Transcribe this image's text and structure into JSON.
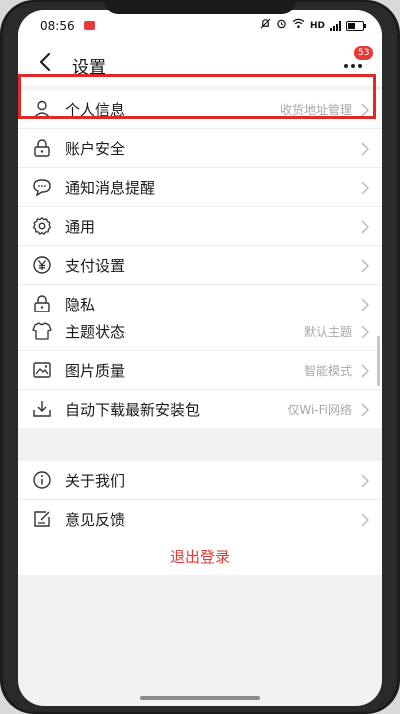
{
  "status_bar": {
    "time": "08:56",
    "network": "HD"
  },
  "header": {
    "title": "设置",
    "badge_count": "53"
  },
  "groups": [
    {
      "items": [
        {
          "label": "个人信息",
          "hint": "收货地址管理",
          "icon": "person-icon"
        },
        {
          "label": "账户安全",
          "hint": "",
          "icon": "lock-icon"
        },
        {
          "label": "通知消息提醒",
          "hint": "",
          "icon": "chat-icon"
        },
        {
          "label": "通用",
          "hint": "",
          "icon": "gear-icon"
        },
        {
          "label": "支付设置",
          "hint": "",
          "icon": "yen-icon"
        },
        {
          "label": "隐私",
          "hint": "",
          "icon": "lock-icon"
        }
      ]
    },
    {
      "items": [
        {
          "label": "主题状态",
          "hint": "默认主题",
          "icon": "shirt-icon"
        },
        {
          "label": "图片质量",
          "hint": "智能模式",
          "icon": "image-icon"
        },
        {
          "label": "自动下载最新安装包",
          "hint": "仅Wi-Fi网络",
          "icon": "download-icon"
        }
      ]
    },
    {
      "items": [
        {
          "label": "关于我们",
          "hint": "",
          "icon": "info-icon"
        },
        {
          "label": "意见反馈",
          "hint": "",
          "icon": "feedback-icon"
        }
      ]
    }
  ],
  "logout_label": "退出登录",
  "colors": {
    "accent": "#e53935",
    "highlight_border": "#e02a2a",
    "background": "#f2f2f2"
  }
}
